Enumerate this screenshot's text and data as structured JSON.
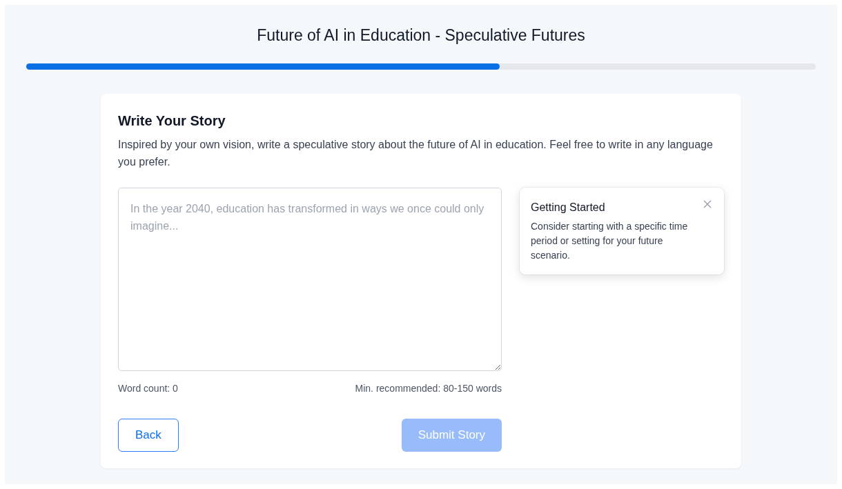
{
  "header": {
    "title": "Future of AI in Education - Speculative Futures",
    "progress": {
      "level": 0.6
    }
  },
  "card": {
    "heading": "Write Your Story",
    "intro": "Inspired by your own vision, write a speculative story about the future of AI in education. Feel free to write in any language you prefer.",
    "story_field": {
      "placeholder": "In the year 2040, education has transformed in ways we once could only imagine..."
    },
    "word_count": "Word count: 0",
    "recommendation": "Min. recommended: 80-150 words",
    "buttons": [
      {
        "kind": "outline",
        "label": "Back",
        "disabled": false
      },
      {
        "kind": "primary",
        "label": "Submit Story",
        "disabled": true
      }
    ]
  },
  "tip": {
    "title": "Getting Started",
    "text": "Consider starting with a specific time period or setting for your future scenario."
  }
}
